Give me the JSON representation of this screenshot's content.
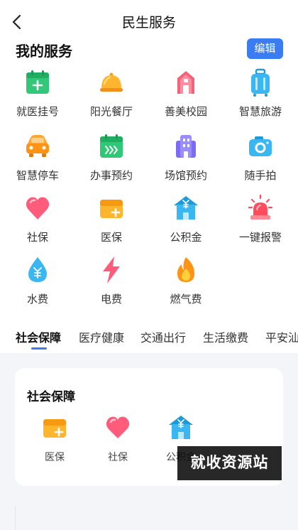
{
  "header": {
    "title": "民生服务",
    "back_icon": "chevron-left-icon"
  },
  "my_services": {
    "title": "我的服务",
    "edit_label": "编辑",
    "items": [
      {
        "label": "就医挂号",
        "icon": "calendar-plus-icon"
      },
      {
        "label": "阳光餐厅",
        "icon": "food-cloche-icon"
      },
      {
        "label": "善美校园",
        "icon": "school-building-icon"
      },
      {
        "label": "智慧旅游",
        "icon": "luggage-icon"
      },
      {
        "label": "智慧停车",
        "icon": "car-icon"
      },
      {
        "label": "办事预约",
        "icon": "calendar-arrows-icon"
      },
      {
        "label": "场馆预约",
        "icon": "venue-building-icon"
      },
      {
        "label": "随手拍",
        "icon": "camera-icon"
      },
      {
        "label": "社保",
        "icon": "heart-icon"
      },
      {
        "label": "医保",
        "icon": "medical-card-icon"
      },
      {
        "label": "公积金",
        "icon": "yuan-house-icon"
      },
      {
        "label": "一键报警",
        "icon": "alarm-light-icon"
      },
      {
        "label": "水费",
        "icon": "water-drop-yuan-icon"
      },
      {
        "label": "电费",
        "icon": "lightning-icon"
      },
      {
        "label": "燃气费",
        "icon": "flame-icon"
      }
    ]
  },
  "tabs": [
    "社会保障",
    "医疗健康",
    "交通出行",
    "生活缴费",
    "平安汕"
  ],
  "active_tab": "社会保障",
  "category_card": {
    "title": "社会保障",
    "items": [
      {
        "label": "医保",
        "icon": "medical-card-icon"
      },
      {
        "label": "社保",
        "icon": "heart-icon"
      },
      {
        "label": "公积金",
        "icon": "yuan-house-icon"
      }
    ]
  },
  "watermark": "就收资源站",
  "colors": {
    "accent": "#3c7cf3",
    "background": "#f4f5f8"
  }
}
